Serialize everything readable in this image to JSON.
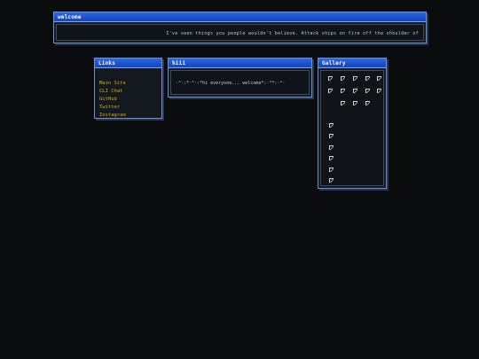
{
  "welcome": {
    "title": "welcome",
    "marquee": "I've seen things you people wouldn't believe. Attack ships on fire off the shoulder of"
  },
  "links": {
    "title": "Links",
    "items": [
      {
        "label": "Main Site"
      },
      {
        "label": "CLI Chat"
      },
      {
        "label": "GitHub"
      },
      {
        "label": "Twitter"
      },
      {
        "label": "Instagram"
      }
    ]
  },
  "hiii": {
    "title": "hiii",
    "message": "·°·:*·°·:*hi everyone... welcome*:·°*:·°·"
  },
  "gallery": {
    "title": "Gallery",
    "image_count": 19,
    "image_icon": "broken-image-icon"
  },
  "colors": {
    "background": "#0b0c0e",
    "titlebar": "#1a4fcf",
    "border": "#6f8fd0",
    "link": "#d4b300"
  }
}
